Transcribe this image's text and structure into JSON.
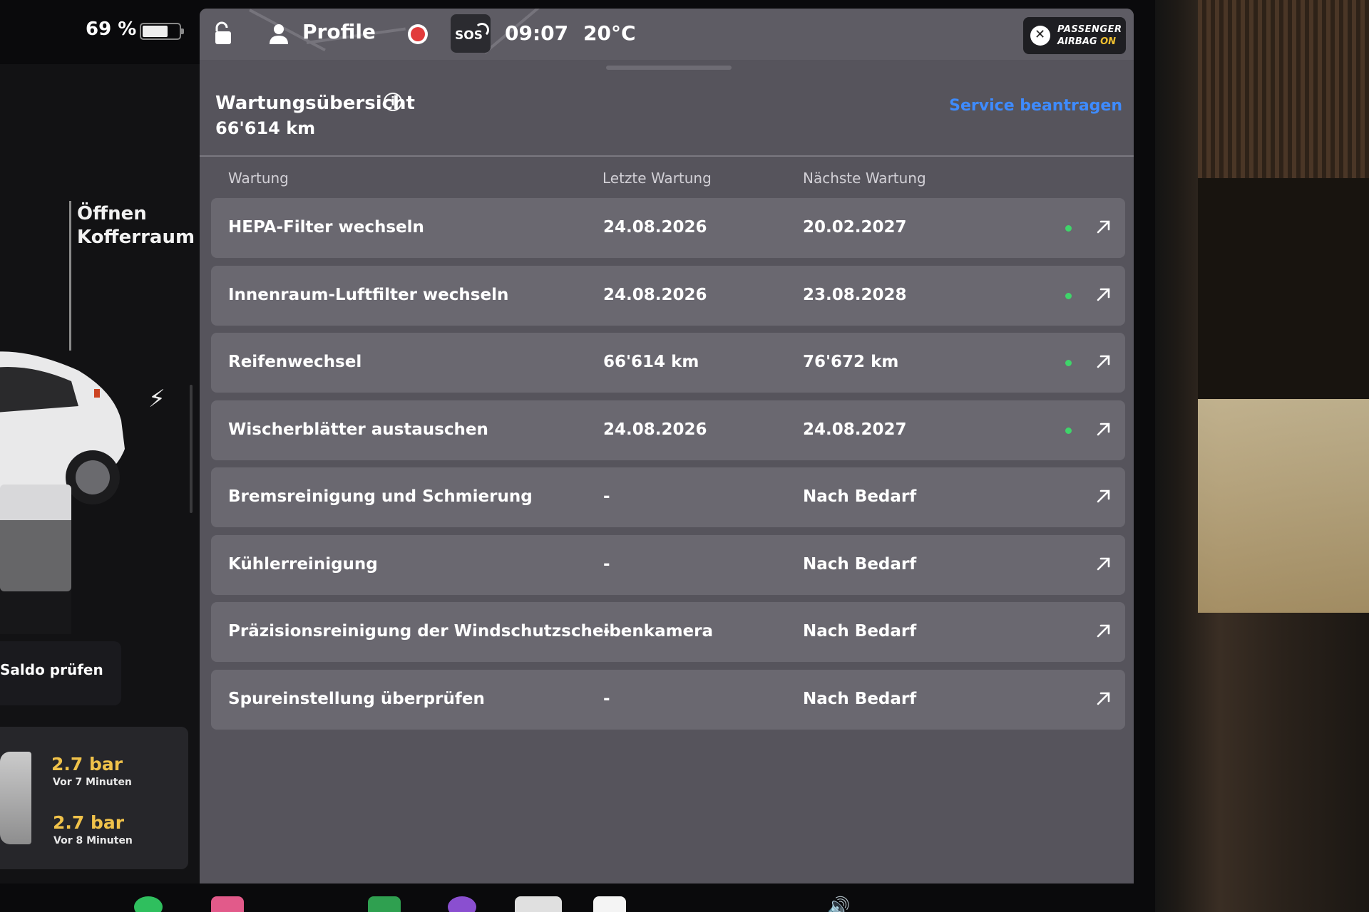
{
  "status": {
    "battery_percent": "69 %",
    "battery_level": 0.69,
    "profile_label": "Profile",
    "time": "09:07",
    "temperature": "20°C",
    "sos_label": "SOS",
    "airbag_line1": "PASSENGER",
    "airbag_line2": "AIRBAG",
    "airbag_state": "ON"
  },
  "car_panel": {
    "trunk_label_line1": "Öffnen",
    "trunk_label_line2": "Kofferraum",
    "saldo_label": "Saldo prüfen",
    "tires": [
      {
        "value": "2.7 bar",
        "time": "Vor 7 Minuten"
      },
      {
        "value": "2.7 bar",
        "time": "Vor 8 Minuten"
      }
    ]
  },
  "maintenance": {
    "title": "Wartungsübersicht",
    "odometer": "66'614  km",
    "service_link": "Service beantragen",
    "columns": {
      "task": "Wartung",
      "last": "Letzte Wartung",
      "next": "Nächste Wartung"
    },
    "rows": [
      {
        "task": "HEPA-Filter wechseln",
        "last": "24.08.2026",
        "next": "20.02.2027",
        "status": "ok"
      },
      {
        "task": "Innenraum-Luftfilter wechseln",
        "last": "24.08.2026",
        "next": "23.08.2028",
        "status": "ok"
      },
      {
        "task": "Reifenwechsel",
        "last": "66'614 km",
        "next": "76'672 km",
        "status": "ok"
      },
      {
        "task": "Wischerblätter austauschen",
        "last": "24.08.2026",
        "next": "24.08.2027",
        "status": "ok"
      },
      {
        "task": "Bremsreinigung und Schmierung",
        "last": "-",
        "next": "Nach Bedarf",
        "status": "none"
      },
      {
        "task": "Kühlerreinigung",
        "last": "-",
        "next": "Nach Bedarf",
        "status": "none"
      },
      {
        "task": "Präzisionsreinigung der Windschutzscheibenkamera",
        "last": "-",
        "next": "Nach Bedarf",
        "status": "none"
      },
      {
        "task": "Spureinstellung überprüfen",
        "last": "-",
        "next": "Nach Bedarf",
        "status": "none"
      }
    ]
  },
  "colors": {
    "accent_link": "#3e8bff",
    "status_ok": "#3fd46a",
    "tire_value": "#f0c24a",
    "panel_bg": "#56545c",
    "row_bg": "#6a6870"
  },
  "icons": [
    "lock-icon",
    "profile-icon",
    "record-icon",
    "sos-icon",
    "airbag-off-icon",
    "info-icon",
    "open-external-icon",
    "bolt-icon"
  ]
}
